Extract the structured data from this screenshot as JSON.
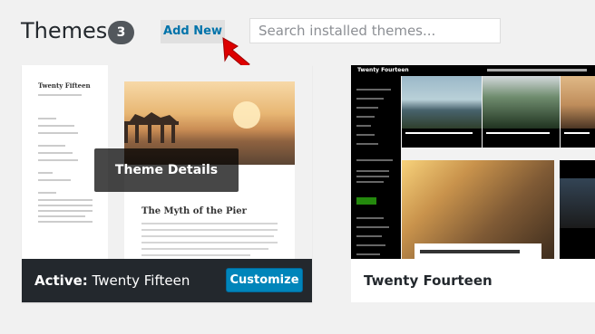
{
  "header": {
    "title": "Themes",
    "count": "3",
    "add_new_label": "Add New",
    "search_placeholder": "Search installed themes..."
  },
  "themes": [
    {
      "preview": {
        "site_title": "Twenty Fifteen",
        "overlay_label": "Theme Details",
        "post_title": "The Myth of the Pier"
      },
      "status_prefix": "Active:",
      "name": "Twenty Fifteen",
      "action_label": "Customize",
      "active": true
    },
    {
      "preview": {
        "site_title": "Twenty Fourteen"
      },
      "name": "Twenty Fourteen",
      "active": false
    }
  ],
  "colors": {
    "accent": "#0085ba",
    "active_bar": "#23282d",
    "annotation_arrow": "#dd0000"
  }
}
